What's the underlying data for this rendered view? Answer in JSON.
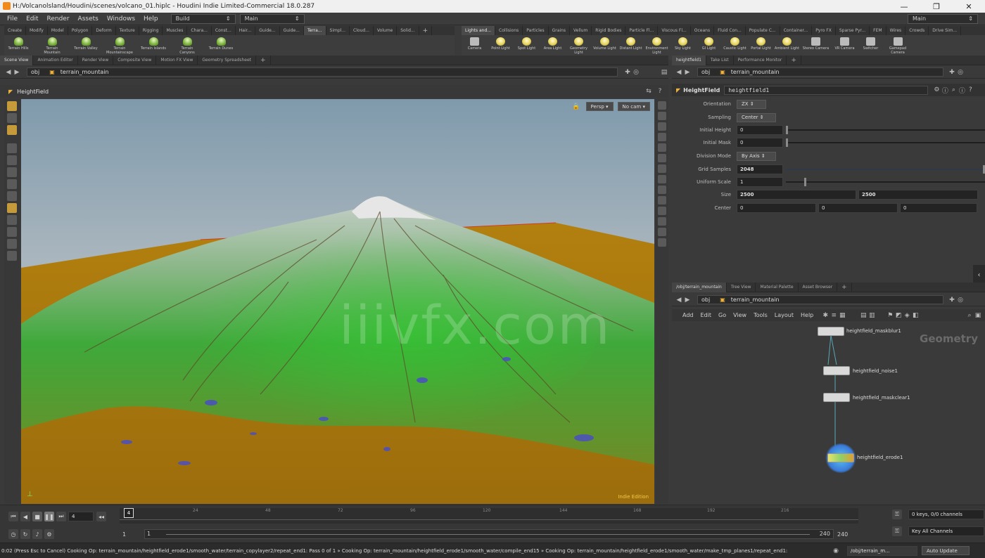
{
  "window": {
    "title": "H:/Volcanolsland/Houdini/scenes/volcano_01.hiplc - Houdini Indie Limited-Commercial 18.0.287",
    "controls": [
      "—",
      "❐",
      "✕"
    ]
  },
  "menu": {
    "items": [
      "File",
      "Edit",
      "Render",
      "Assets",
      "Windows",
      "Help"
    ],
    "desktop": "Build",
    "context": "Main",
    "right_desktop": "Main"
  },
  "shelf_left": {
    "tabs": [
      "Create",
      "Modify",
      "Model",
      "Polygon",
      "Deform",
      "Texture",
      "Rigging",
      "Muscles",
      "Chara...",
      "Const...",
      "Hair...",
      "Guide...",
      "Guide...",
      "Terra...",
      "Simpl...",
      "Cloud...",
      "Volume",
      "Solid..."
    ],
    "active_tab": 13,
    "tools": [
      "Terrain Hills",
      "Terrain Mountain",
      "Terrain Valley",
      "Terrain Mountainscape",
      "Terrain Islands",
      "Terrain Canyons",
      "Terrain Dunes"
    ]
  },
  "shelf_right": {
    "tabs": [
      "Lights and...",
      "Collisions",
      "Particles",
      "Grains",
      "Vellum",
      "Rigid Bodies",
      "Particle Fl...",
      "Viscous Fl...",
      "Oceans",
      "Fluid Con...",
      "Populate C...",
      "Container...",
      "Pyro FX",
      "Sparse Pyr...",
      "FEM",
      "Wires",
      "Crowds",
      "Drive Sim..."
    ],
    "tools": [
      "Camera",
      "Point Light",
      "Spot Light",
      "Area Light",
      "Geometry Light",
      "Volume Light",
      "Distant Light",
      "Environment Light",
      "Sky Light",
      "GI Light",
      "Caustic Light",
      "Portal Light",
      "Ambient Light",
      "Stereo Camera",
      "VR Camera",
      "Switcher",
      "Gamepad Camera"
    ]
  },
  "left_pane": {
    "tabs": [
      "Scene View",
      "Animation Editor",
      "Render View",
      "Composite View",
      "Motion FX View",
      "Geometry Spreadsheet"
    ],
    "path_root": "obj",
    "path_node": "terrain_mountain",
    "viewer_label": "HeightField",
    "view_persp": "Persp",
    "view_cam": "No cam",
    "edition_badge": "Indie Edition",
    "watermark": "iiivfx.com"
  },
  "param_pane": {
    "tabs": [
      "heightfield1",
      "Take List",
      "Performance Monitor"
    ],
    "path_root": "obj",
    "path_node": "terrain_mountain",
    "node_type": "HeightField",
    "node_name": "heightfield1",
    "params": {
      "orientation": {
        "label": "Orientation",
        "value": "ZX"
      },
      "sampling": {
        "label": "Sampling",
        "value": "Center"
      },
      "initial_height": {
        "label": "Initial Height",
        "value": "0"
      },
      "initial_mask": {
        "label": "Initial Mask",
        "value": "0"
      },
      "division_mode": {
        "label": "Division Mode",
        "value": "By Axis"
      },
      "grid_samples": {
        "label": "Grid Samples",
        "value": "2048"
      },
      "uniform_scale": {
        "label": "Uniform Scale",
        "value": "1"
      },
      "size": {
        "label": "Size",
        "x": "2500",
        "y": "2500"
      },
      "center": {
        "label": "Center",
        "x": "0",
        "y": "0",
        "z": "0"
      }
    }
  },
  "network_pane": {
    "tabs": [
      "/obj/terrain_mountain",
      "Tree View",
      "Material Palette",
      "Asset Browser"
    ],
    "path_root": "obj",
    "path_node": "terrain_mountain",
    "menu": [
      "Add",
      "Edit",
      "Go",
      "View",
      "Tools",
      "Layout",
      "Help"
    ],
    "context_label": "Geometry",
    "nodes": [
      {
        "name": "heightfield_maskblur1"
      },
      {
        "name": "heightfield_noise1"
      },
      {
        "name": "heightfield_maskclear1"
      },
      {
        "name": "heightfield_erode1"
      }
    ]
  },
  "timeline": {
    "current_frame": "4",
    "marker_frame": "4",
    "ticks": [
      "24",
      "48",
      "72",
      "96",
      "120",
      "144",
      "168",
      "192",
      "216"
    ],
    "start": "1",
    "range_start": "1",
    "range_end": "240",
    "end": "240",
    "keys_info": "0 keys, 0/0 channels",
    "key_all_label": "Key All Channels"
  },
  "status": {
    "message": "0:02 (Press Esc to Cancel) Cooking Op: terrain_mountain/heightfield_erode1/smooth_water/terrain_copylayer2/repeat_end1: Pass 0 of 1 » Cooking Op: terrain_mountain/heightfield_erode1/smooth_water/compile_end15 » Cooking Op: terrain_mountain/heightfield_erode1/smooth_water/make_tmp_planes1/repeat_end1:",
    "path": "/obj/terrain_m...",
    "auto_update": "Auto Update"
  }
}
